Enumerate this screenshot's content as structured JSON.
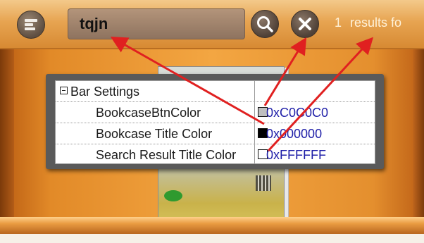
{
  "toolbar": {
    "search_value": "tqjn",
    "result_count": "1",
    "result_text": "results fo"
  },
  "properties": {
    "group_label": "Bar Settings",
    "rows": [
      {
        "name": "BookcaseBtnColor",
        "value": "0xC0C0C0",
        "swatch": "#C0C0C0"
      },
      {
        "name": "Bookcase Title Color",
        "value": "0x000000",
        "swatch": "#000000"
      },
      {
        "name": "Search Result Title Color",
        "value": "0xFFFFFF",
        "swatch": "#FFFFFF"
      }
    ]
  },
  "colors": {
    "annotation_arrow": "#e02020",
    "value_text": "#1f1fa8"
  },
  "icons": [
    "menu-icon",
    "search-icon",
    "close-icon",
    "collapse-icon"
  ]
}
